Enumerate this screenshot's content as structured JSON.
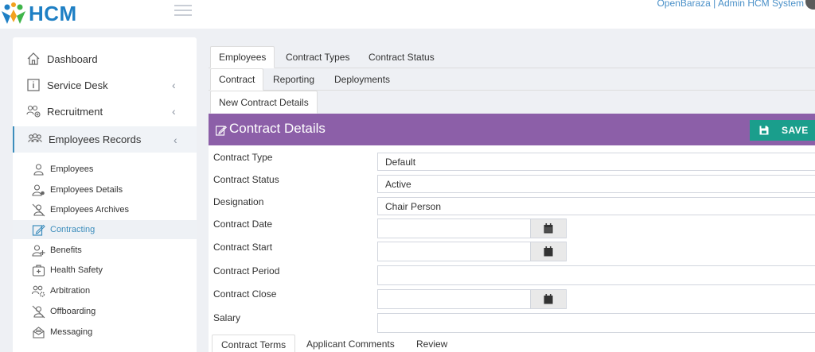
{
  "app": {
    "logo_text": "HCM",
    "header_title": "OpenBaraza | Admin HCM System"
  },
  "sidebar": {
    "main_items": [
      {
        "label": "Dashboard",
        "icon": "home-icon",
        "has_chevron": false
      },
      {
        "label": "Service Desk",
        "icon": "info-icon",
        "has_chevron": true
      },
      {
        "label": "Recruitment",
        "icon": "users-add-icon",
        "has_chevron": true
      },
      {
        "label": "Employees Records",
        "icon": "users-group-icon",
        "has_chevron": true,
        "active": true
      }
    ],
    "chevron_glyph": "‹",
    "sub_items": [
      {
        "label": "Employees",
        "icon": "user-icon"
      },
      {
        "label": "Employees Details",
        "icon": "user-details-icon"
      },
      {
        "label": "Employees Archives",
        "icon": "user-archive-icon"
      },
      {
        "label": "Contracting",
        "icon": "contract-edit-icon",
        "active": true
      },
      {
        "label": "Benefits",
        "icon": "user-plus-icon"
      },
      {
        "label": "Health Safety",
        "icon": "health-kit-icon"
      },
      {
        "label": "Arbitration",
        "icon": "users-cog-icon"
      },
      {
        "label": "Offboarding",
        "icon": "user-remove-icon"
      },
      {
        "label": "Messaging",
        "icon": "envelope-icon"
      }
    ]
  },
  "tabs_level1": [
    {
      "label": "Employees",
      "active": true
    },
    {
      "label": "Contract Types"
    },
    {
      "label": "Contract Status"
    }
  ],
  "tabs_level2": [
    {
      "label": "Contract",
      "active": true
    },
    {
      "label": "Reporting"
    },
    {
      "label": "Deployments"
    }
  ],
  "tabs_level3": [
    {
      "label": "New Contract Details",
      "active": true
    }
  ],
  "panel": {
    "title": "Contract Details",
    "save_label": "SAVE"
  },
  "form": {
    "fields": [
      {
        "label": "Contract Type",
        "value": "Default",
        "kind": "select"
      },
      {
        "label": "Contract Status",
        "value": "Active",
        "kind": "select"
      },
      {
        "label": "Designation",
        "value": "Chair Person",
        "kind": "select"
      },
      {
        "label": "Contract Date",
        "value": "",
        "kind": "date"
      },
      {
        "label": "Contract Start",
        "value": "",
        "kind": "date"
      },
      {
        "label": "Contract Period",
        "value": "",
        "kind": "text"
      },
      {
        "label": "Contract Close",
        "value": "",
        "kind": "date"
      },
      {
        "label": "Salary",
        "value": "",
        "kind": "text"
      }
    ]
  },
  "bottom_tabs": [
    {
      "label": "Contract Terms",
      "active": true
    },
    {
      "label": "Applicant Comments"
    },
    {
      "label": "Review"
    }
  ],
  "colors": {
    "brand_blue": "#1e7fc4",
    "panel_purple": "#8c5fa8",
    "save_teal": "#1a9e8c",
    "active_link": "#3c8dbc"
  }
}
